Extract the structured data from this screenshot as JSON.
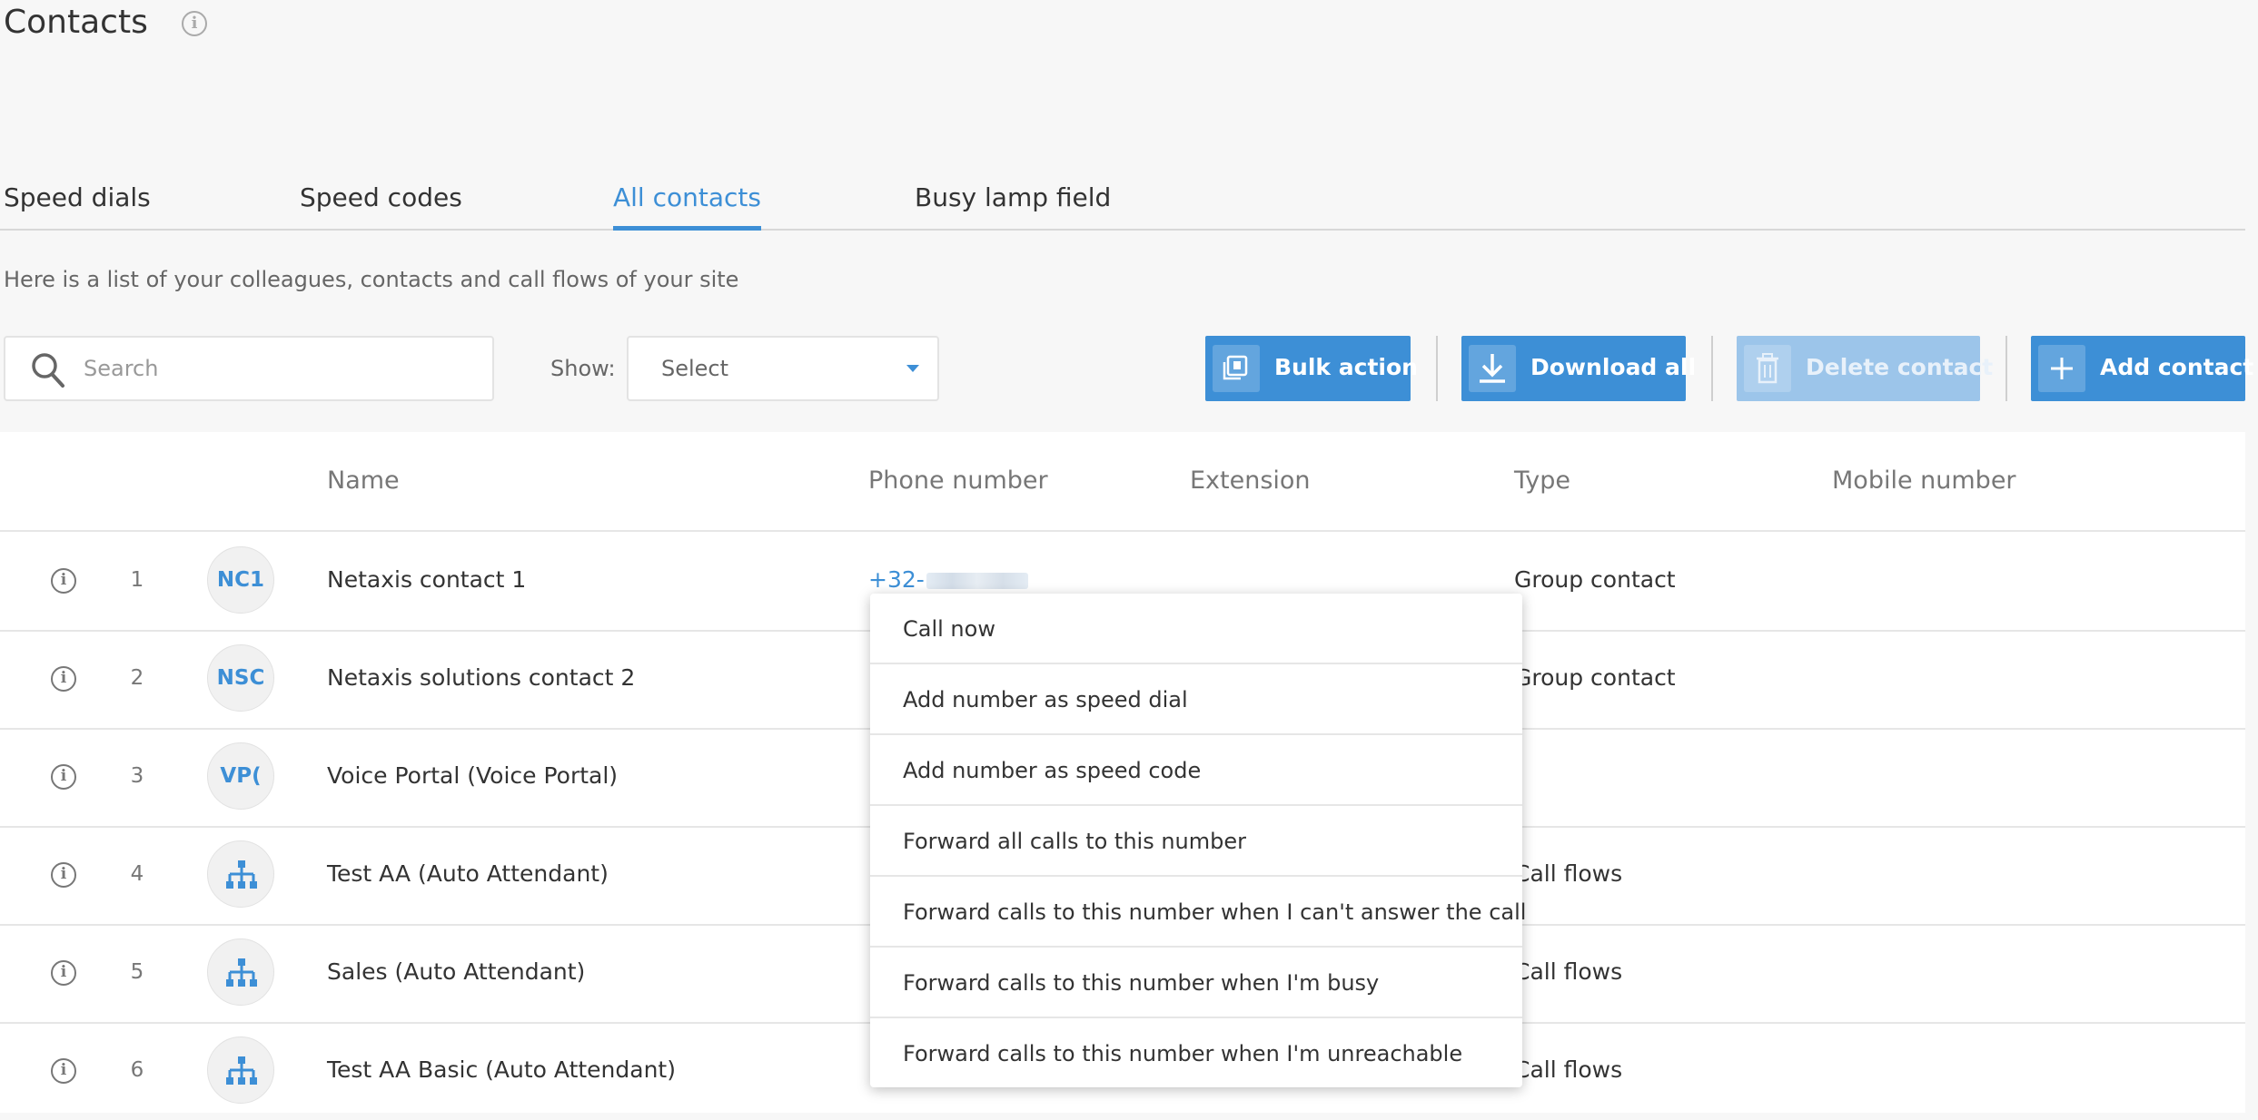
{
  "page": {
    "title": "Contacts",
    "subtitle": "Here is a list of your colleagues, contacts and call flows of your site"
  },
  "tabs": [
    {
      "label": "Speed dials"
    },
    {
      "label": "Speed codes"
    },
    {
      "label": "All contacts",
      "active": true
    },
    {
      "label": "Busy lamp field"
    }
  ],
  "toolbar": {
    "search_placeholder": "Search",
    "show_label": "Show:",
    "show_value": "Select",
    "bulk_action": "Bulk action",
    "download_all": "Download all",
    "delete_contact": "Delete contact",
    "add_contact": "Add contact"
  },
  "table": {
    "headers": {
      "name": "Name",
      "phone": "Phone number",
      "extension": "Extension",
      "type": "Type",
      "mobile": "Mobile number"
    },
    "rows": [
      {
        "num": "1",
        "avatar": "NC1",
        "icon": "",
        "name": "Netaxis contact 1",
        "phone": "+32-",
        "type": "Group contact"
      },
      {
        "num": "2",
        "avatar": "NSC",
        "icon": "",
        "name": "Netaxis solutions contact 2",
        "phone": "",
        "type": "Group contact"
      },
      {
        "num": "3",
        "avatar": "VP(",
        "icon": "",
        "name": "Voice Portal (Voice Portal)",
        "phone": "",
        "type": ""
      },
      {
        "num": "4",
        "avatar": "",
        "icon": "hierarchy-icon",
        "name": "Test AA (Auto Attendant)",
        "phone": "",
        "type": "Call flows"
      },
      {
        "num": "5",
        "avatar": "",
        "icon": "hierarchy-icon",
        "name": "Sales (Auto Attendant)",
        "phone": "",
        "type": "Call flows"
      },
      {
        "num": "6",
        "avatar": "",
        "icon": "hierarchy-icon",
        "name": "Test AA Basic (Auto Attendant)",
        "phone": "",
        "type": "Call flows"
      }
    ]
  },
  "context_menu": {
    "items": [
      "Call now",
      "Add number as speed dial",
      "Add number as speed code",
      "Forward all calls to this number",
      "Forward calls to this number when I can't answer the call",
      "Forward calls to this number when I'm busy",
      "Forward calls to this number when I'm unreachable"
    ]
  },
  "colors": {
    "accent": "#3d8fd6",
    "accent_disabled": "#9cc5ea"
  }
}
